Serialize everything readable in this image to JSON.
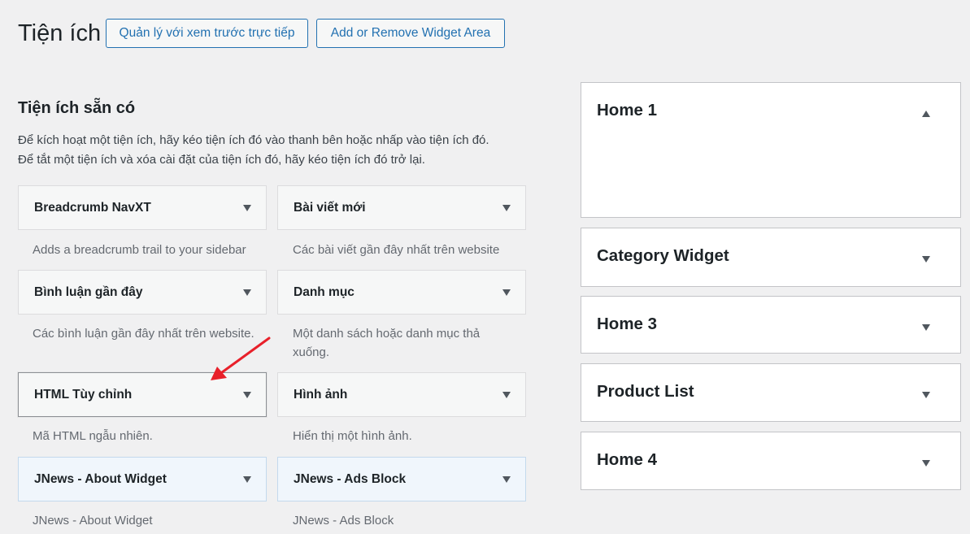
{
  "header": {
    "title": "Tiện ích",
    "manage_live_preview": "Quản lý với xem trước trực tiếp",
    "add_remove_area": "Add or Remove Widget Area"
  },
  "available": {
    "title": "Tiện ích sẵn có",
    "description_line1": "Để kích hoạt một tiện ích, hãy kéo tiện ích đó vào thanh bên hoặc nhấp vào tiện ích đó.",
    "description_line2": "Để tắt một tiện ích và xóa cài đặt của tiện ích đó, hãy kéo tiện ích đó trở lại.",
    "widgets": [
      {
        "title": "Breadcrumb NavXT",
        "description": "Adds a breadcrumb trail to your sidebar"
      },
      {
        "title": "Bài viết mới",
        "description": "Các bài viết gần đây nhất trên website"
      },
      {
        "title": "Bình luận gần đây",
        "description": "Các bình luận gần đây nhất trên website."
      },
      {
        "title": "Danh mục",
        "description": "Một danh sách hoặc danh mục thả xuống."
      },
      {
        "title": "HTML Tùy chỉnh",
        "description": "Mã HTML ngẫu nhiên."
      },
      {
        "title": "Hình ảnh",
        "description": "Hiển thị một hình ảnh."
      },
      {
        "title": "JNews - About Widget",
        "description": "JNews - About Widget"
      },
      {
        "title": "JNews - Ads Block",
        "description": "JNews - Ads Block"
      }
    ]
  },
  "widget_areas": [
    {
      "title": "Home 1",
      "expanded": true
    },
    {
      "title": "Category Widget",
      "expanded": false
    },
    {
      "title": "Home 3",
      "expanded": false
    },
    {
      "title": "Product List",
      "expanded": false
    },
    {
      "title": "Home 4",
      "expanded": false
    }
  ],
  "colors": {
    "accent": "#2271b1",
    "annotation_arrow": "#e8202a",
    "background": "#f0f0f1"
  },
  "icons": {
    "widget_toggle": "triangle-down-icon",
    "area_collapse": "triangle-up-icon",
    "annotation": "red-arrow-icon"
  }
}
